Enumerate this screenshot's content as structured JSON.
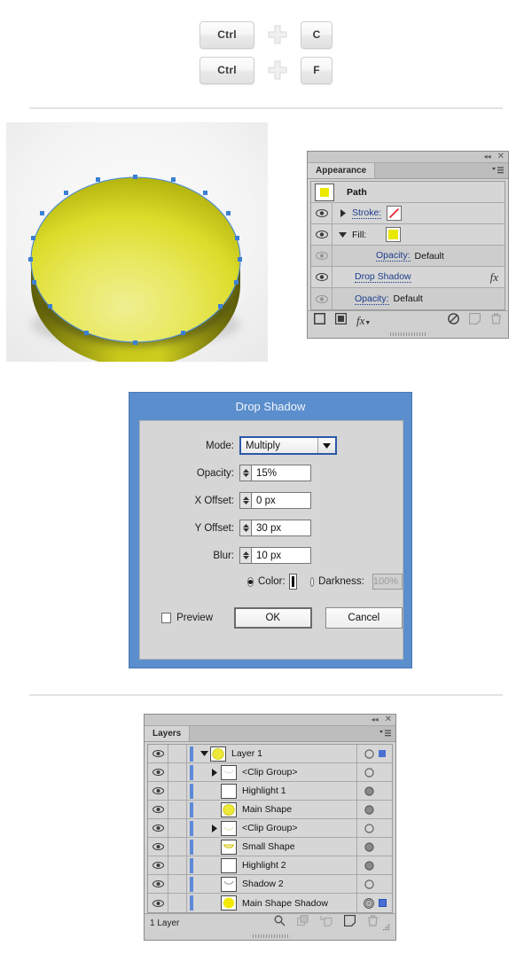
{
  "shortcuts": {
    "rows": [
      {
        "first": "Ctrl",
        "plus_icon": "plus-icon",
        "second": "C"
      },
      {
        "first": "Ctrl",
        "plus_icon": "plus-icon",
        "second": "F"
      }
    ]
  },
  "artwork": {
    "name": "yellow-disc-illustration",
    "description": "Yellow 3D disc with selected vector path and anchor points",
    "colors": {
      "top_light": "#e9e96a",
      "top_mid": "#e2e23a",
      "top_dark": "#b8b815",
      "side_dark": "#6f6f0c",
      "side_mid": "#c6c61a",
      "anchor": "#3b7fd4",
      "path_stroke": "#4a8ad6",
      "backdrop": "#f2f2f3"
    }
  },
  "appearance_panel": {
    "topbar": {
      "collapse_icon": "collapse-icon",
      "close_icon": "close-icon"
    },
    "tab_label": "Appearance",
    "menu_icon": "panel-menu-icon",
    "item_name": "Path",
    "rows": [
      {
        "kind": "header",
        "label": "Path",
        "thumb": "path-thumb",
        "visible": null,
        "disclosure": null
      },
      {
        "kind": "stroke",
        "label": "Stroke:",
        "visible": true,
        "disclosure": "collapsed",
        "swatch": "none-swatch",
        "swatch_color": "none"
      },
      {
        "kind": "fill",
        "label": "Fill:",
        "visible": true,
        "disclosure": "expanded",
        "swatch": "fill-swatch",
        "swatch_color": "#e8e800"
      },
      {
        "kind": "opacity",
        "label": "Opacity:",
        "value": "Default",
        "visible": false,
        "indent": true
      },
      {
        "kind": "effect",
        "label": "Drop Shadow",
        "visible": true,
        "fx_icon": "fx-icon"
      },
      {
        "kind": "opacity",
        "label": "Opacity:",
        "value": "Default",
        "visible": false,
        "indent": false
      }
    ],
    "footer_icons": [
      "add-new-stroke-icon",
      "add-new-fill-icon",
      "add-new-effect-icon",
      "clear-appearance-icon",
      "duplicate-item-icon",
      "delete-item-icon"
    ]
  },
  "drop_shadow_dialog": {
    "title": "Drop Shadow",
    "title_bar_color": "#5b8ecd",
    "fields": [
      {
        "label": "Mode:",
        "type": "select",
        "value": "Multiply",
        "name": "mode-select"
      },
      {
        "label": "Opacity:",
        "type": "stepper-text",
        "value": "15%",
        "name": "opacity-field"
      },
      {
        "label": "X Offset:",
        "type": "stepper-text",
        "value": "0 px",
        "name": "x-offset-field"
      },
      {
        "label": "Y Offset:",
        "type": "stepper-text",
        "value": "30 px",
        "name": "y-offset-field"
      },
      {
        "label": "Blur:",
        "type": "stepper-text",
        "value": "10 px",
        "name": "blur-field"
      }
    ],
    "color_option": {
      "label": "Color:",
      "selected": true,
      "swatch": "#0d0d0d"
    },
    "darkness_option": {
      "label": "Darkness:",
      "selected": false,
      "value": "100%",
      "disabled": true
    },
    "preview": {
      "label": "Preview",
      "checked": false
    },
    "ok_label": "OK",
    "cancel_label": "Cancel"
  },
  "layers_panel": {
    "topbar": {
      "collapse_icon": "collapse-icon",
      "close_icon": "close-icon"
    },
    "tab_label": "Layers",
    "menu_icon": "panel-menu-icon",
    "rows": [
      {
        "name": "Layer 1",
        "indent": 0,
        "disclosure": "expanded",
        "thumb": "yellow-circle-thumb",
        "target": "open-circle",
        "selection_square": "#4a6fd4",
        "visible": true
      },
      {
        "name": "<Clip Group>",
        "indent": 1,
        "disclosure": "collapsed",
        "thumb": "white-arc-thumb",
        "target": "open-circle",
        "selection_square": null,
        "visible": true
      },
      {
        "name": "Highlight 1",
        "indent": 1,
        "disclosure": "none",
        "thumb": "white-thumb",
        "target": "filled-circle",
        "selection_square": null,
        "visible": true
      },
      {
        "name": "Main Shape",
        "indent": 1,
        "disclosure": "none",
        "thumb": "yellow-circle-thumb",
        "target": "filled-circle",
        "selection_square": null,
        "visible": true
      },
      {
        "name": "<Clip Group>",
        "indent": 1,
        "disclosure": "collapsed",
        "thumb": "faint-arc-thumb",
        "target": "open-circle",
        "selection_square": null,
        "visible": true
      },
      {
        "name": "Small Shape",
        "indent": 1,
        "disclosure": "none",
        "thumb": "yellow-arc-thumb",
        "target": "filled-circle",
        "selection_square": null,
        "visible": true
      },
      {
        "name": "Highlight 2",
        "indent": 1,
        "disclosure": "none",
        "thumb": "white-thumb",
        "target": "filled-circle",
        "selection_square": null,
        "visible": true
      },
      {
        "name": "Shadow 2",
        "indent": 1,
        "disclosure": "none",
        "thumb": "gray-arc-thumb",
        "target": "open-circle",
        "selection_square": null,
        "visible": true
      },
      {
        "name": "Main Shape Shadow",
        "indent": 1,
        "disclosure": "none",
        "thumb": "yellow-solid-thumb",
        "target": "target-circle",
        "selection_square": "#4a6fd4",
        "visible": true
      }
    ],
    "footer_count": "1 Layer",
    "footer_icons": [
      "locate-object-icon",
      "make-clipping-mask-icon",
      "create-sublayer-icon",
      "create-new-layer-icon",
      "delete-selection-icon"
    ]
  }
}
